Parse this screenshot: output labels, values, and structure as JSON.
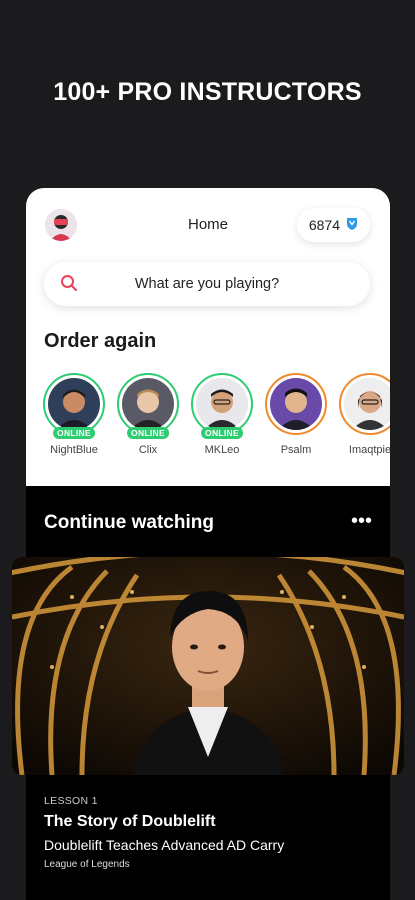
{
  "headline": "100+ PRO INSTRUCTORS",
  "header": {
    "title": "Home",
    "coins": "6874",
    "coin_icon": "shield-coin-icon"
  },
  "search": {
    "placeholder": "What are you playing?"
  },
  "order_again": {
    "title": "Order again",
    "instructors": [
      {
        "name": "NightBlue",
        "status": "ONLINE",
        "ring": "green"
      },
      {
        "name": "Clix",
        "status": "ONLINE",
        "ring": "green"
      },
      {
        "name": "MKLeo",
        "status": "ONLINE",
        "ring": "green"
      },
      {
        "name": "Psalm",
        "status": "",
        "ring": "orange"
      },
      {
        "name": "Imaqtpie",
        "status": "",
        "ring": "orange"
      }
    ]
  },
  "continue_watching": {
    "title": "Continue watching",
    "more_icon": "more-dots-icon",
    "lesson": {
      "label": "LESSON 1",
      "title": "The Story of Doublelift",
      "subtitle": "Doublelift Teaches Advanced AD Carry",
      "game": "League of Legends"
    }
  },
  "colors": {
    "background": "#1b1a1d",
    "online": "#2ecc71",
    "orange_ring": "#f08a2b",
    "search_icon": "#e8435a",
    "coin": "#2e9be6"
  }
}
